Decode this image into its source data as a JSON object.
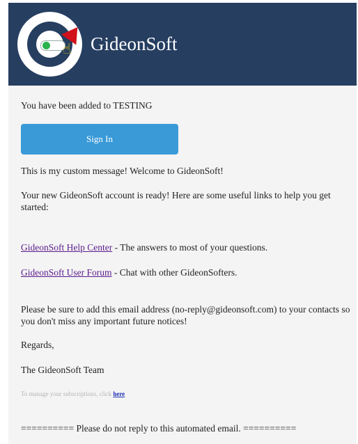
{
  "header": {
    "brand": "GideonSoft",
    "logo_icon": "gideonsoft-logo-icon",
    "colors": {
      "header_bg": "#263e60",
      "button": "#3a9ad8",
      "link": "#5a1a8c"
    }
  },
  "body": {
    "added_text": "You have been added to TESTING",
    "signin_label": "Sign In",
    "custom_message": "This is my custom message! Welcome to GideonSoft!",
    "ready_text": "Your new GideonSoft account is ready! Here are some useful links to help you get started:",
    "help_link": "GideonSoft Help Center",
    "help_desc": " - The answers to most of your questions.",
    "forum_link": "GideonSoft User Forum",
    "forum_desc": " - Chat with other GideonSofters.",
    "contacts_text": "Please be sure to add this email address (no-reply@gideonsoft.com) to your contacts so you don't miss any important future notices!",
    "regards": "Regards,",
    "team": "The GideonSoft Team",
    "manage_text": "To manage your subscriptions, click ",
    "manage_link": "here",
    "footer": "========== Please do not reply to this automated email. =========="
  }
}
